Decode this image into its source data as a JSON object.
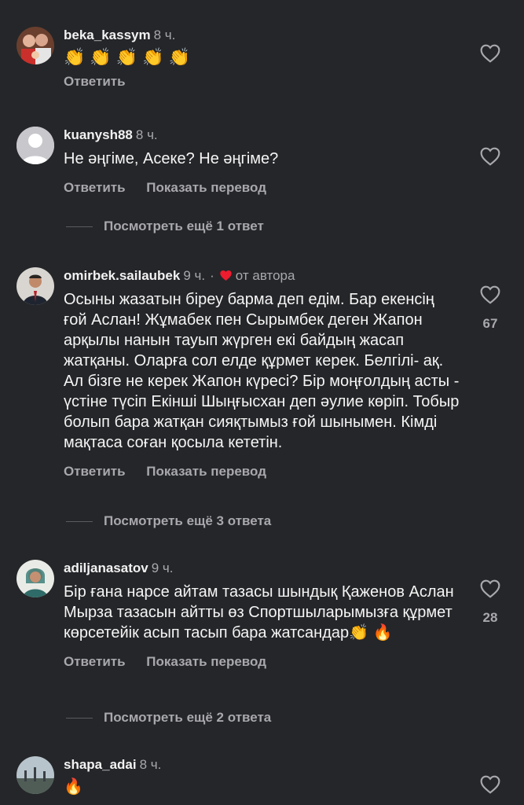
{
  "comments": [
    {
      "username": "beka_kassym",
      "time": "8 ч.",
      "text": "👏👏👏👏👏",
      "reply_label": "Ответить"
    },
    {
      "username": "kuanysh88",
      "time": "8 ч.",
      "text": "Не әңгіме, Асеке? Не әңгіме?",
      "reply_label": "Ответить",
      "translate_label": "Показать перевод",
      "more_replies": "Посмотреть ещё 1 ответ"
    },
    {
      "username": "omirbek.sailaubek",
      "time": "9 ч.",
      "liked_by_author": "от автора",
      "text": "Осыны жазатын біреу барма деп едім. Бар екенсің ғой Аслан! Жұмабек пен Сырымбек деген Жапон арқылы нанын тауып жүрген екі байдың жасап жатқаны. Оларға сол елде құрмет керек. Белгілі- ақ. Ал бізге не керек Жапон күресі? Бір моңғолдың асты - үстіне түсіп Екінші Шыңғысхан деп әулие көріп. Тобыр болып бара жатқан сияқтымыз ғой шынымен. Кімді мақтаса соған қосыла кететін.",
      "likes": "67",
      "reply_label": "Ответить",
      "translate_label": "Показать перевод",
      "more_replies": "Посмотреть ещё 3 ответа"
    },
    {
      "username": "adiljanasatov",
      "time": "9 ч.",
      "text": "Бір ғана нарсе айтам тазасы шындық Қаженов Аслан Мырза тазасын айтты өз Спортшыларымызға құрмет көрсетейік асып тасып бара жатсандар👏 🔥",
      "likes": "28",
      "reply_label": "Ответить",
      "translate_label": "Показать перевод",
      "more_replies": "Посмотреть ещё 2 ответа"
    },
    {
      "username": "shapa_adai",
      "time": "8 ч.",
      "text": "🔥"
    }
  ],
  "colors": {
    "background": "#252629",
    "secondary_text": "#a8a8ad",
    "author_heart": "#ed1c2e"
  }
}
